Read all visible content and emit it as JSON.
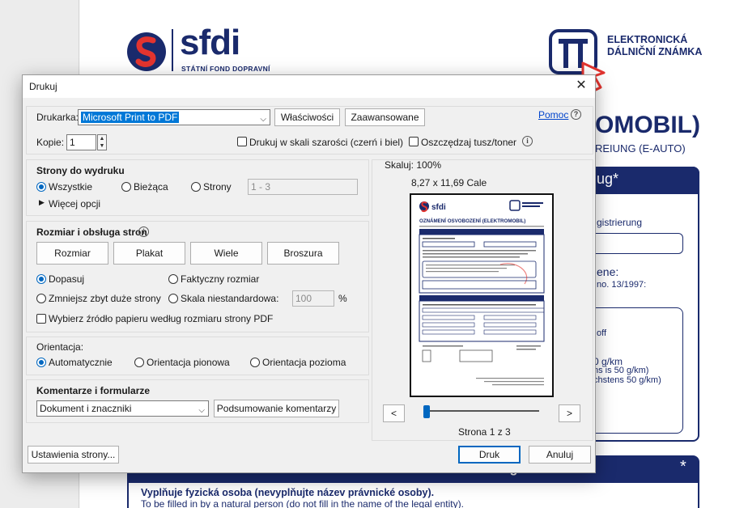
{
  "background_document": {
    "logo_text": "sfdi",
    "logo_subtitle": "STÁTNÍ FOND DOPRAVNÍ",
    "vignette_line1": "ELEKTRONICKÁ",
    "vignette_line2": "DÁLNIČNÍ ZNÁMKA",
    "title_fragment": "OMOBIL)",
    "subtitle_fragment": "REIUNG (E-AUTO)",
    "panel_heading_fragment": "ug*",
    "text_registrierung": "gistrierung",
    "text_ene": "ene:",
    "text_no": "no. 13/1997:",
    "text_off": "off",
    "text_gkm": "0 g/km",
    "text_ns": "ns is 50 g/km)",
    "text_chstens": "chstens 50 g/km)",
    "bottom_heading_fragment": "em Anzeigenden",
    "bottom_heading_star": "*",
    "bottom_line1": "Vyplňuje fyzická osoba (nevyplňujte název právnické osoby).",
    "bottom_line2": "To be filled in by a natural person (do not fill in the name of the legal entity)."
  },
  "dialog": {
    "title": "Drukuj",
    "close_glyph": "✕",
    "printer_label": "Drukarka:",
    "printer_value": "Microsoft Print to PDF",
    "properties_button": "Właściwości",
    "advanced_button": "Zaawansowane",
    "help_link": "Pomoc",
    "help_glyph": "?",
    "copies_label": "Kopie:",
    "copies_value": "1",
    "grayscale_label": "Drukuj w skali szarości (czerń i biel)",
    "save_ink_label": "Oszczędzaj tusz/toner",
    "info_glyph": "i",
    "pages_section": {
      "title": "Strony do wydruku",
      "all": "Wszystkie",
      "current": "Bieżąca",
      "pages": "Strony",
      "pages_range": "1 - 3",
      "more_options": "Więcej opcji"
    },
    "sizing_section": {
      "title": "Rozmiar i obsługa stron",
      "size_button": "Rozmiar",
      "poster_button": "Plakat",
      "multiple_button": "Wiele",
      "booklet_button": "Broszura",
      "fit": "Dopasuj",
      "actual_size": "Faktyczny rozmiar",
      "shrink": "Zmniejsz zbyt duże strony",
      "custom_scale": "Skala niestandardowa:",
      "scale_value": "100",
      "percent": "%",
      "paper_source": "Wybierz źródło papieru według rozmiaru strony PDF"
    },
    "orientation_section": {
      "title": "Orientacja:",
      "auto": "Automatycznie",
      "portrait": "Orientacja pionowa",
      "landscape": "Orientacja pozioma"
    },
    "comments_section": {
      "title": "Komentarze i formularze",
      "select_value": "Dokument i znaczniki",
      "summarize_button": "Podsumowanie komentarzy"
    },
    "preview": {
      "scale_text": "Skaluj: 100%",
      "size_text": "8,27 x 11,69 Cale",
      "prev_glyph": "<",
      "next_glyph": ">",
      "page_text": "Strona 1 z 3",
      "thumb_title": "OZNÁMENÍ OSVOBOZENÍ (ELEKTROMOBIL)",
      "thumb_logo": "sfdi"
    },
    "page_setup_button": "Ustawienia strony...",
    "print_button": "Druk",
    "cancel_button": "Anuluj"
  }
}
